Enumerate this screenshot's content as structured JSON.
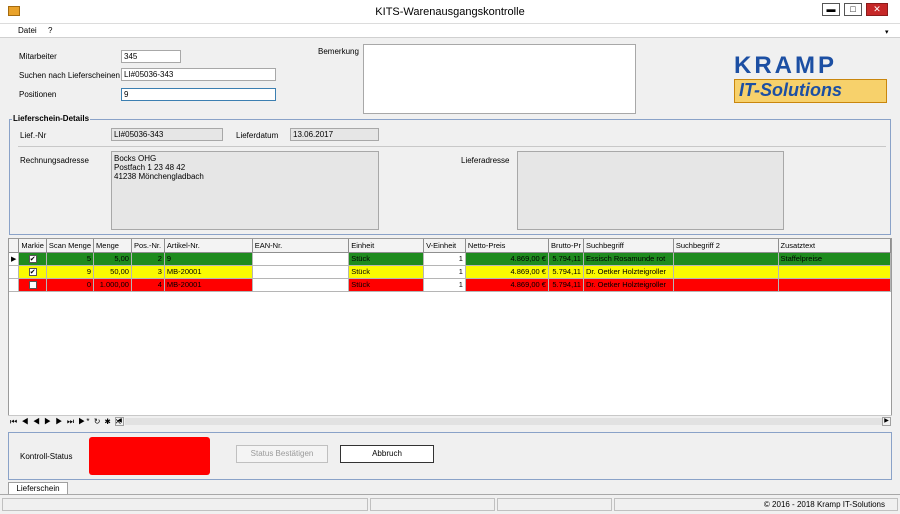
{
  "window": {
    "title": "KITS-Warenausgangskontrolle",
    "minimize": "▬",
    "maximize": "□",
    "close": "✕"
  },
  "menu": {
    "items": [
      "Datei",
      "?"
    ]
  },
  "form": {
    "mitarbeiter_label": "Mitarbeiter",
    "mitarbeiter_value": "345",
    "suchen_label": "Suchen nach Lieferscheinen",
    "suchen_value": "LI#05036-343",
    "positionen_label": "Positionen",
    "positionen_value": "9",
    "bemerkung_label": "Bemerkung"
  },
  "logo": {
    "line1": "KRAMP",
    "line2": "IT-Solutions",
    "colors": {
      "blue": "#1c4fa3",
      "orange": "#f28c00"
    }
  },
  "details": {
    "title": "Lieferschein-Details",
    "lief_nr_label": "Lief.-Nr",
    "lief_nr_value": "LI#05036-343",
    "lieferdatum_label": "Lieferdatum",
    "lieferdatum_value": "13.06.2017",
    "rechnungsadresse_label": "Rechnungsadresse",
    "rechnungsadresse_value": "Bocks OHG\nPostfach 1 23 48 42\n41238 Mönchengladbach",
    "lieferadresse_label": "Lieferadresse"
  },
  "grid": {
    "columns": [
      "Markie",
      "Scan Menge",
      "Menge",
      "Pos.-Nr.",
      "Artikel-Nr.",
      "EAN-Nr.",
      "Einheit",
      "V-Einheit",
      "Netto-Preis",
      "Brutto-Pr",
      "Suchbegriff",
      "Suchbegriff 2",
      "Zusatztext"
    ],
    "rows": [
      {
        "color": "green",
        "checked": true,
        "scan": "5",
        "menge": "5,00",
        "pos": "2",
        "artikel": "9",
        "ean": "",
        "einheit": "Stück",
        "veinheit": "1",
        "netto": "4.869,00 €",
        "brutto": "5.794,11",
        "such": "Essisch Rosamunde rot",
        "such2": "",
        "zusatz": "Staffelpreise"
      },
      {
        "color": "yellow",
        "checked": true,
        "scan": "9",
        "menge": "50,00",
        "pos": "3",
        "artikel": "MB-20001",
        "ean": "",
        "einheit": "Stück",
        "veinheit": "1",
        "netto": "4.869,00 €",
        "brutto": "5.794,11",
        "such": "Dr. Oetker Holzteigroller",
        "such2": "",
        "zusatz": ""
      },
      {
        "color": "red",
        "checked": false,
        "scan": "0",
        "menge": "1.000,00",
        "pos": "4",
        "artikel": "MB-20001",
        "ean": "",
        "einheit": "Stück",
        "veinheit": "1",
        "netto": "4.869,00 €",
        "brutto": "5.794,11",
        "such": "Dr. Oetker Holzteigroller",
        "such2": "",
        "zusatz": ""
      }
    ],
    "nav_glyphs": "⏮ ◀ ◀ ▶ ▶ ⏭ ▶* ↻ ✱ ✕ ⊽"
  },
  "status": {
    "label": "Kontroll-Status",
    "color": "#ff0000",
    "confirm_button": "Status Bestätigen",
    "cancel_button": "Abbruch"
  },
  "tabs": [
    "Lieferschein"
  ],
  "statusbar": {
    "copyright": "© 2016 - 2018 Kramp IT-Solutions"
  }
}
